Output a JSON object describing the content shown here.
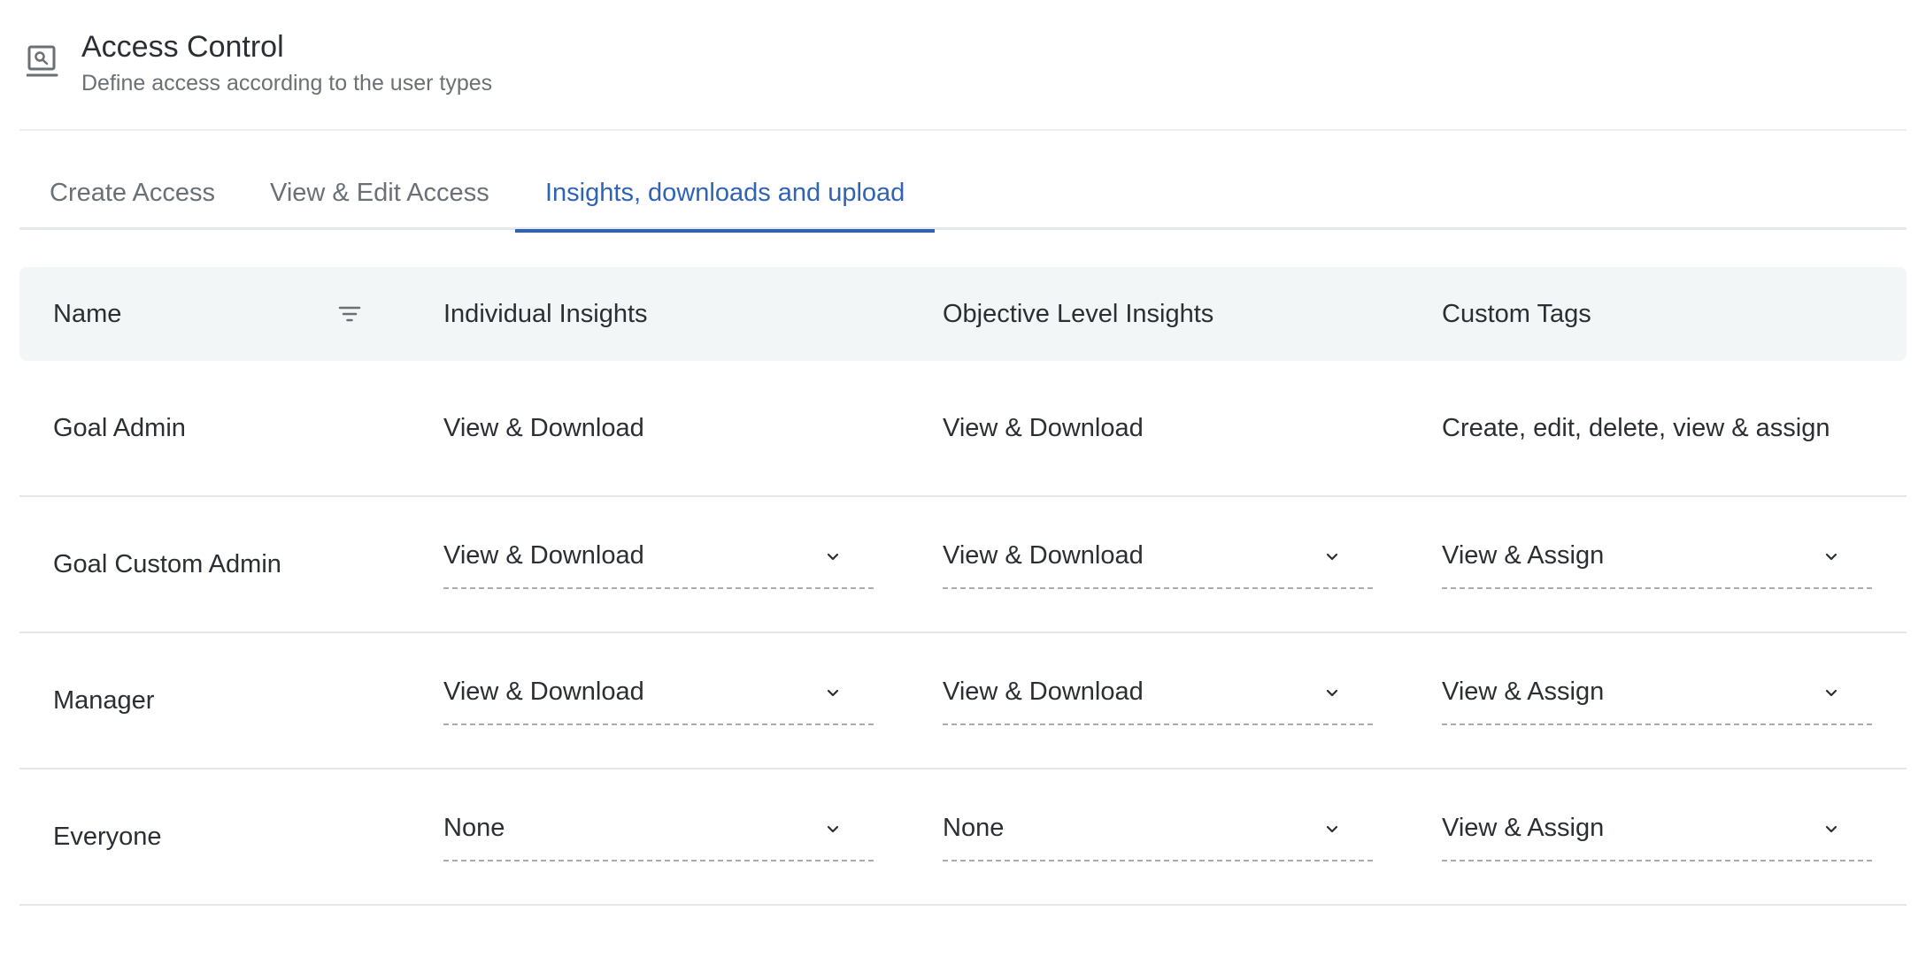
{
  "header": {
    "icon": "monitor-search-icon",
    "title": "Access Control",
    "subtitle": "Define access according to the user types"
  },
  "tabs": [
    {
      "label": "Create Access",
      "active": false
    },
    {
      "label": "View & Edit Access",
      "active": false
    },
    {
      "label": "Insights, downloads and upload",
      "active": true
    }
  ],
  "colors": {
    "accent": "#2f63b5",
    "header_bg": "#f3f6f7"
  },
  "table": {
    "columns": [
      "Name",
      "Individual Insights",
      "Objective Level Insights",
      "Custom Tags"
    ],
    "filter_icon": "filter-icon",
    "rows": [
      {
        "name": "Goal Admin",
        "editable": false,
        "individual": "View & Download",
        "objective": "View & Download",
        "tags": "Create, edit, delete, view & assign"
      },
      {
        "name": "Goal Custom Admin",
        "editable": true,
        "individual": "View & Download",
        "objective": "View & Download",
        "tags": "View & Assign"
      },
      {
        "name": "Manager",
        "editable": true,
        "individual": "View & Download",
        "objective": "View & Download",
        "tags": "View & Assign"
      },
      {
        "name": "Everyone",
        "editable": true,
        "individual": "None",
        "objective": "None",
        "tags": "View & Assign"
      }
    ]
  }
}
